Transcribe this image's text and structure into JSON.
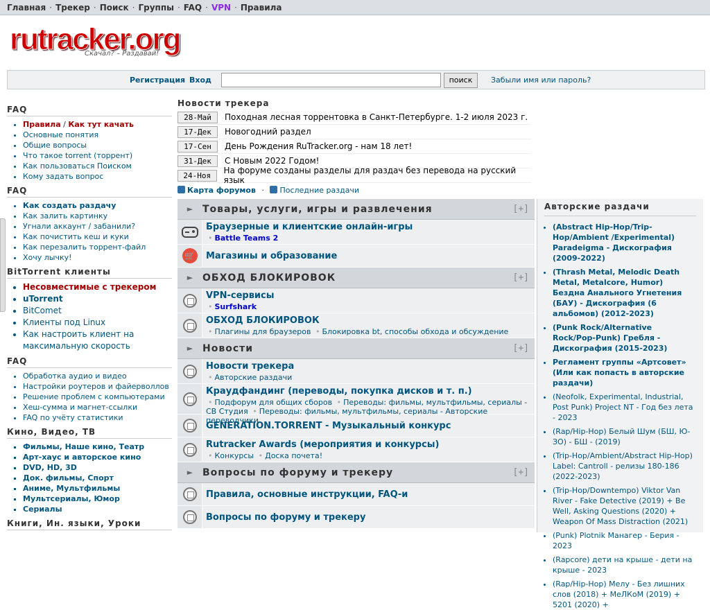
{
  "topnav": [
    "Главная",
    "Трекер",
    "Поиск",
    "Группы",
    "FAQ",
    "VPN",
    "Правила"
  ],
  "logo": {
    "brand": "rutracker.org",
    "tagline": "Скачал? – Раздавай!"
  },
  "login": {
    "register": "Регистрация",
    "dot": "·",
    "enter": "Вход",
    "search_button": "поиск",
    "forgot": "Забыли имя или пароль?"
  },
  "left": [
    {
      "title": "FAQ",
      "items": [
        [
          "Правила",
          "red"
        ],
        [
          "Основные понятия",
          ""
        ],
        [
          "Общие вопросы",
          ""
        ],
        [
          "Что такое torrent (торрент)",
          ""
        ],
        [
          "Как пользоваться Поиском",
          ""
        ],
        [
          "Кому задать вопрос",
          ""
        ]
      ],
      "first_extra": "Как тут качать"
    },
    {
      "title": "FAQ",
      "items": [
        [
          "Как создать раздачу",
          "bold"
        ],
        [
          "Как залить картинку",
          ""
        ],
        [
          "Угнали аккаунт / забанили?",
          ""
        ],
        [
          "Как почистить кеш и куки",
          ""
        ],
        [
          "Как перезалить торрент-файл",
          ""
        ],
        [
          "Хочу лычку!",
          ""
        ]
      ]
    },
    {
      "title": "BitTorrent клиенты",
      "big": true,
      "items": [
        [
          "Несовместимые с трекером",
          "red"
        ],
        [
          "uTorrent",
          "bold"
        ],
        [
          "BitComet",
          ""
        ],
        [
          "Клиенты под Linux",
          ""
        ],
        [
          "Как настроить клиент на максимальную скорость",
          ""
        ]
      ]
    },
    {
      "title": "FAQ",
      "items": [
        [
          "Обработка аудио и видео",
          ""
        ],
        [
          "Настройки роутеров и файерволлов",
          ""
        ],
        [
          "Решение проблем с компьютерами",
          ""
        ],
        [
          "Хеш-сумма и магнет-ссылки",
          ""
        ],
        [
          "FAQ по учёту статистики",
          ""
        ]
      ]
    },
    {
      "title": "Кино, Видео, ТВ",
      "sq": true,
      "items": [
        [
          "Фильмы, Наше кино, Театр",
          "bold"
        ],
        [
          "Арт-хаус и авторское кино",
          "bold"
        ],
        [
          "DVD, HD, 3D",
          "bold"
        ],
        [
          "Док. фильмы, Спорт",
          "bold"
        ],
        [
          "Аниме, Мультфильмы",
          "bold"
        ],
        [
          "Мультсериалы, Юмор",
          "bold"
        ],
        [
          "Сериалы",
          "bold"
        ]
      ]
    },
    {
      "title": "Книги, Ин. языки, Уроки",
      "items": []
    }
  ],
  "news": {
    "title": "Новости трекера",
    "items": [
      {
        "date": "28-Май",
        "text": "Походная лесная торрентовка в Санкт-Петербурге. 1-2 июля 2023 г."
      },
      {
        "date": "17-Дек",
        "text": "Новогодний раздел"
      },
      {
        "date": "17-Сен",
        "text": "День Рождения RuTracker.org - нам 18 лет!"
      },
      {
        "date": "31-Дек",
        "text": "С Новым 2022 Годом!"
      },
      {
        "date": "24-Ноя",
        "text": "На форуме созданы разделы для раздач без перевода на русский язык"
      }
    ]
  },
  "links": {
    "map": "Карта форумов",
    "sep": "·",
    "latest": "Последние раздачи"
  },
  "forum": [
    {
      "cat": "Товары, услуги, игры и развлечения",
      "toggle": "[+]",
      "rows": [
        {
          "icon": "gamepad",
          "name": "Браузерные и клиентские онлайн-игры",
          "subs": [
            "Battle Teams 2"
          ],
          "hl": true
        },
        {
          "icon": "shop",
          "name": "Магазины и образование",
          "subs": []
        }
      ]
    },
    {
      "cat": "ОБХОД БЛОКИРОВОК",
      "toggle": "[+]",
      "rows": [
        {
          "icon": "forum",
          "name": "VPN-сервисы",
          "subs": [
            "Surfshark"
          ],
          "hl": true
        },
        {
          "icon": "forum",
          "name": "ОБХОД БЛОКИРОВОК",
          "subs": [
            "Плагины для браузеров",
            "Блокировка bt, способы обхода и обсуждение"
          ]
        }
      ]
    },
    {
      "cat": "Новости",
      "toggle": "[+]",
      "rows": [
        {
          "icon": "forum",
          "name": "Новости трекера",
          "subs": [
            "Авторские раздачи"
          ]
        },
        {
          "icon": "forum",
          "name": "Краудфандинг (переводы, покупка дисков и т. п.)",
          "subs": [
            "Подфорум для общих сборов",
            "Переводы: фильмы, мультфильмы, сериалы - СВ Студия",
            "Переводы: фильмы, мультфильмы, сериалы - Авторские переводчики"
          ]
        },
        {
          "icon": "forum",
          "name": "GENERATION.TORRENT - Музыкальный конкурс",
          "subs": []
        },
        {
          "icon": "forum",
          "name": "Rutracker Awards (мероприятия и конкурсы)",
          "subs": [
            "Конкурсы",
            "Доска почета!"
          ]
        }
      ]
    },
    {
      "cat": "Вопросы по форуму и трекеру",
      "toggle": "[+]",
      "rows": [
        {
          "icon": "forum",
          "name": "Правила, основные инструкции, FAQ-и",
          "subs": []
        },
        {
          "icon": "forum",
          "name": "Вопросы по форуму и трекеру",
          "subs": []
        }
      ]
    }
  ],
  "right": {
    "title": "Авторские раздачи",
    "items": [
      [
        "(Abstract Hip-Hop/Trip-Hop/Ambient /Experimental) Paradeigma - Дискография (2009-2022)",
        "bold"
      ],
      [
        "(Thrash Metal, Melodic Death Metal, Metalcore, Humor) Бездна Анального Угнетения (БАУ) - Дискография (6 альбомов) (2012-2023)",
        "bold"
      ],
      [
        "(Punk Rock/Alternative Rock/Pop-Punk) Гребля - Дискография (2015-2023)",
        "bold"
      ],
      [
        "Регламент группы «Артсовет» (Или как попасть в авторские раздачи)",
        "bold"
      ],
      [
        "(Neofolk, Experimental, Industrial, Post Punk) Project NT - Год без лета - 2023",
        ""
      ],
      [
        "(Rap/Hip-Hop) Белый Шум (БШ, Ю-ЗО) - БШ - (2019)",
        ""
      ],
      [
        "(Trip-Hop/Ambient/Abstract Hip-Hop) Label: Cantroll - релизы 180-186 (2022-2023)",
        ""
      ],
      [
        "(Trip-Hop/Downtempo) Viktor Van River - Fake Detective (2019) + Be Well, Asking Questions (2020) + Weapon Of Mass Distraction (2021)",
        ""
      ],
      [
        "(Punk) Plotnik Манагер - Берия - 2023",
        ""
      ],
      [
        "(Rapcore) дети на крыше - дети на крыше - 2023",
        ""
      ],
      [
        "(Rap/Hip-Hop) Мелу - Без лишних слов (2018) + МеЛКоМ (2019) + 5201 (2020) +",
        ""
      ]
    ]
  }
}
